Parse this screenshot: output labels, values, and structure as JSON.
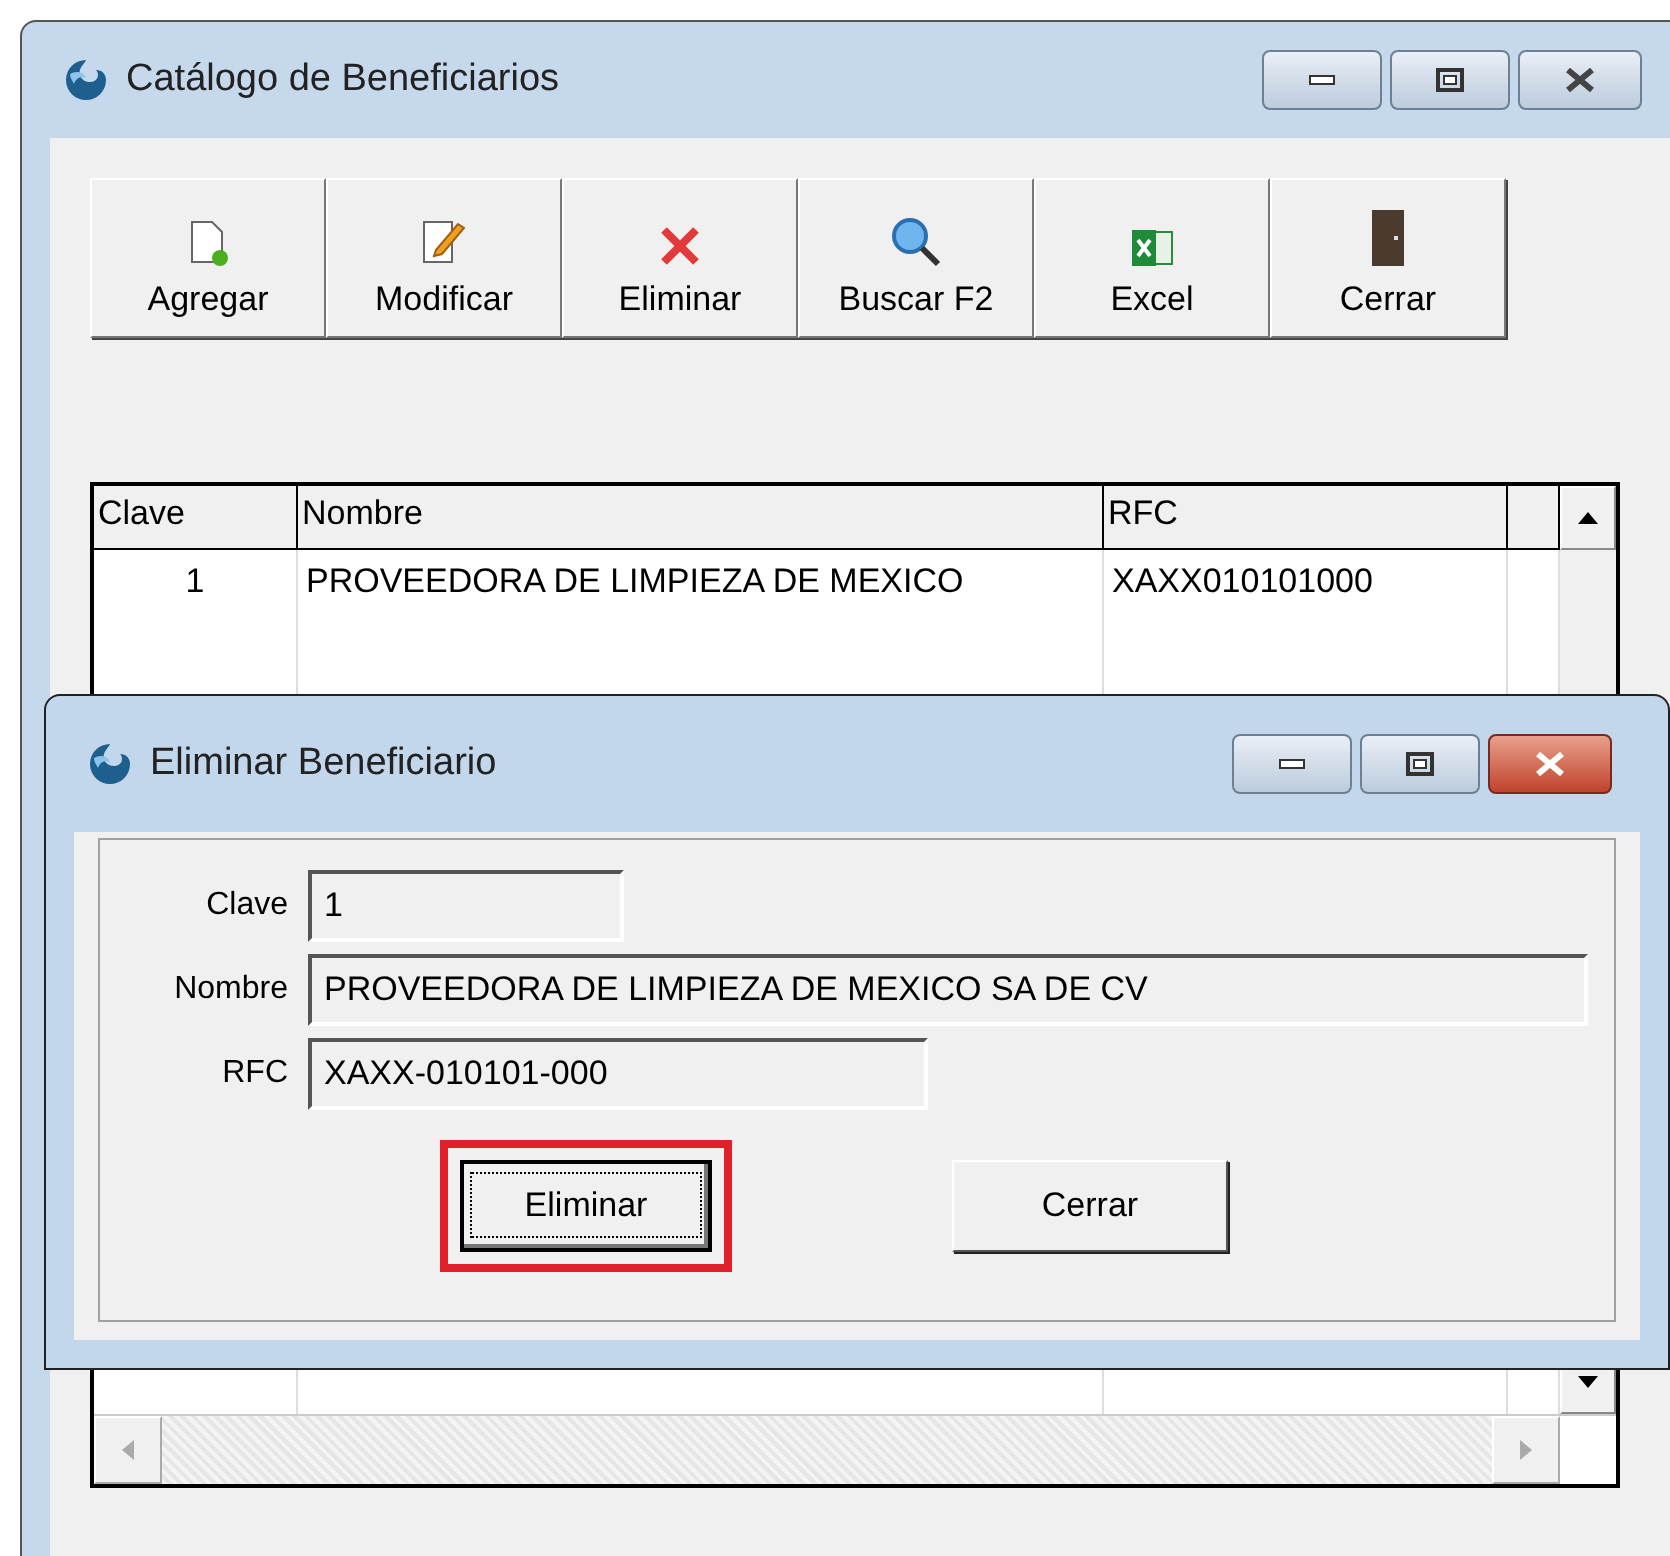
{
  "main_window": {
    "title": "Catálogo de Beneficiarios",
    "active": false
  },
  "toolbar": [
    {
      "kind": "add",
      "label": "Agregar"
    },
    {
      "kind": "edit",
      "label": "Modificar"
    },
    {
      "kind": "delete",
      "label": "Eliminar"
    },
    {
      "kind": "search",
      "label": "Buscar F2"
    },
    {
      "kind": "excel",
      "label": "Excel"
    },
    {
      "kind": "exit",
      "label": "Cerrar"
    }
  ],
  "table": {
    "columns": [
      "Clave",
      "Nombre",
      "RFC"
    ],
    "rows": [
      [
        "1",
        "PROVEEDORA DE LIMPIEZA DE MEXICO",
        "XAXX010101000"
      ]
    ]
  },
  "dialog": {
    "title": "Eliminar Beneficiario",
    "active": true,
    "fields": [
      {
        "label": "Clave",
        "value": "1"
      },
      {
        "label": "Nombre",
        "value": "PROVEEDORA DE LIMPIEZA DE MEXICO SA DE CV"
      },
      {
        "label": "RFC",
        "value": "XAXX-010101-000"
      }
    ],
    "buttons": [
      {
        "label": "Eliminar",
        "focused": true,
        "highlighted": true
      },
      {
        "label": "Cerrar",
        "focused": false,
        "highlighted": false
      }
    ]
  }
}
